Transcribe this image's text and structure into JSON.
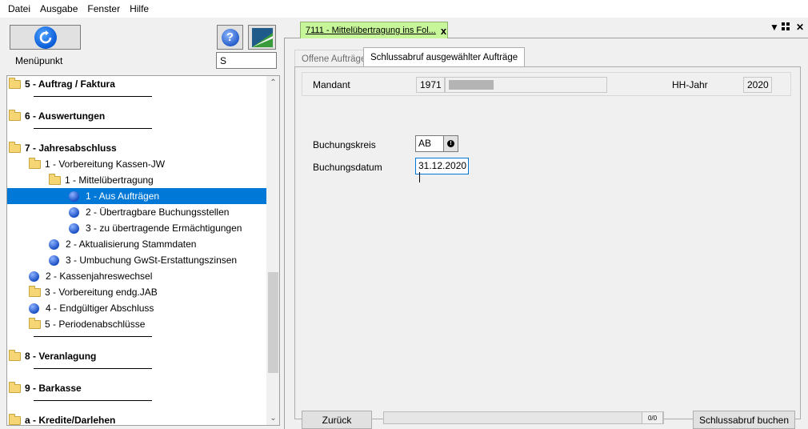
{
  "menubar": {
    "items": [
      "Datei",
      "Ausgabe",
      "Fenster",
      "Hilfe"
    ]
  },
  "left": {
    "menulabel": "Menüpunkt",
    "search_value": "S",
    "tree": [
      {
        "label": "5 - Auftrag / Faktura",
        "bold": true,
        "icon": "folder-icon",
        "level": 0
      },
      {
        "label": "6 - Auswertungen",
        "bold": true,
        "icon": "folder-icon",
        "level": 0
      },
      {
        "label": "7 - Jahresabschluss",
        "bold": true,
        "icon": "folder-icon",
        "level": 0
      },
      {
        "label": "1 - Vorbereitung Kassen-JW",
        "bold": false,
        "icon": "folder-icon",
        "level": 1
      },
      {
        "label": "1 - Mittelübertragung",
        "bold": false,
        "icon": "folder-icon",
        "level": 2
      },
      {
        "label": "1 - Aus Aufträgen",
        "bold": false,
        "icon": "bullet-icon",
        "level": 3,
        "selected": true
      },
      {
        "label": "2 - Übertragbare Buchungsstellen",
        "bold": false,
        "icon": "bullet-icon",
        "level": 3
      },
      {
        "label": "3 - zu übertragende Ermächtigungen",
        "bold": false,
        "icon": "bullet-icon",
        "level": 3
      },
      {
        "label": "2 - Aktualisierung Stammdaten",
        "bold": false,
        "icon": "bullet-icon",
        "level": 2
      },
      {
        "label": "3 - Umbuchung GwSt-Erstattungszinsen",
        "bold": false,
        "icon": "bullet-icon",
        "level": 2
      },
      {
        "label": "2 - Kassenjahreswechsel",
        "bold": false,
        "icon": "bullet-icon",
        "level": 1
      },
      {
        "label": "3 - Vorbereitung endg.JAB",
        "bold": false,
        "icon": "folder-icon",
        "level": 1
      },
      {
        "label": "4 - Endgültiger Abschluss",
        "bold": false,
        "icon": "bullet-icon",
        "level": 1
      },
      {
        "label": "5 - Periodenabschlüsse",
        "bold": false,
        "icon": "folder-icon",
        "level": 1
      },
      {
        "label": "8 - Veranlagung",
        "bold": true,
        "icon": "folder-icon",
        "level": 0
      },
      {
        "label": "9 - Barkasse",
        "bold": true,
        "icon": "folder-icon",
        "level": 0
      },
      {
        "label": "a - Kredite/Darlehen",
        "bold": true,
        "icon": "folder-icon",
        "level": 0
      }
    ]
  },
  "right": {
    "doc_tab_title": "7111 - Mittelübertragung ins Fol...",
    "doc_tab_close": "x",
    "tabs": {
      "inactive": "Offene Aufträge",
      "active": "Schlussabruf ausgewählter Aufträge"
    },
    "mandant_label": "Mandant",
    "mandant_value": "1971",
    "hhjahr_label": "HH-Jahr",
    "hhjahr_value": "2020",
    "buchungskreis_label": "Buchungskreis",
    "buchungskreis_value": "AB",
    "buchungsdatum_label": "Buchungsdatum",
    "buchungsdatum_value": "31.12.2020",
    "back_button": "Zurück",
    "progress_count": "0/0",
    "progress_fraction": 0,
    "submit_button": "Schlussabruf buchen"
  },
  "colors": {
    "selection": "#0078d7",
    "doc_tab": "#c7f59a",
    "accent": "#0a5bd6"
  }
}
